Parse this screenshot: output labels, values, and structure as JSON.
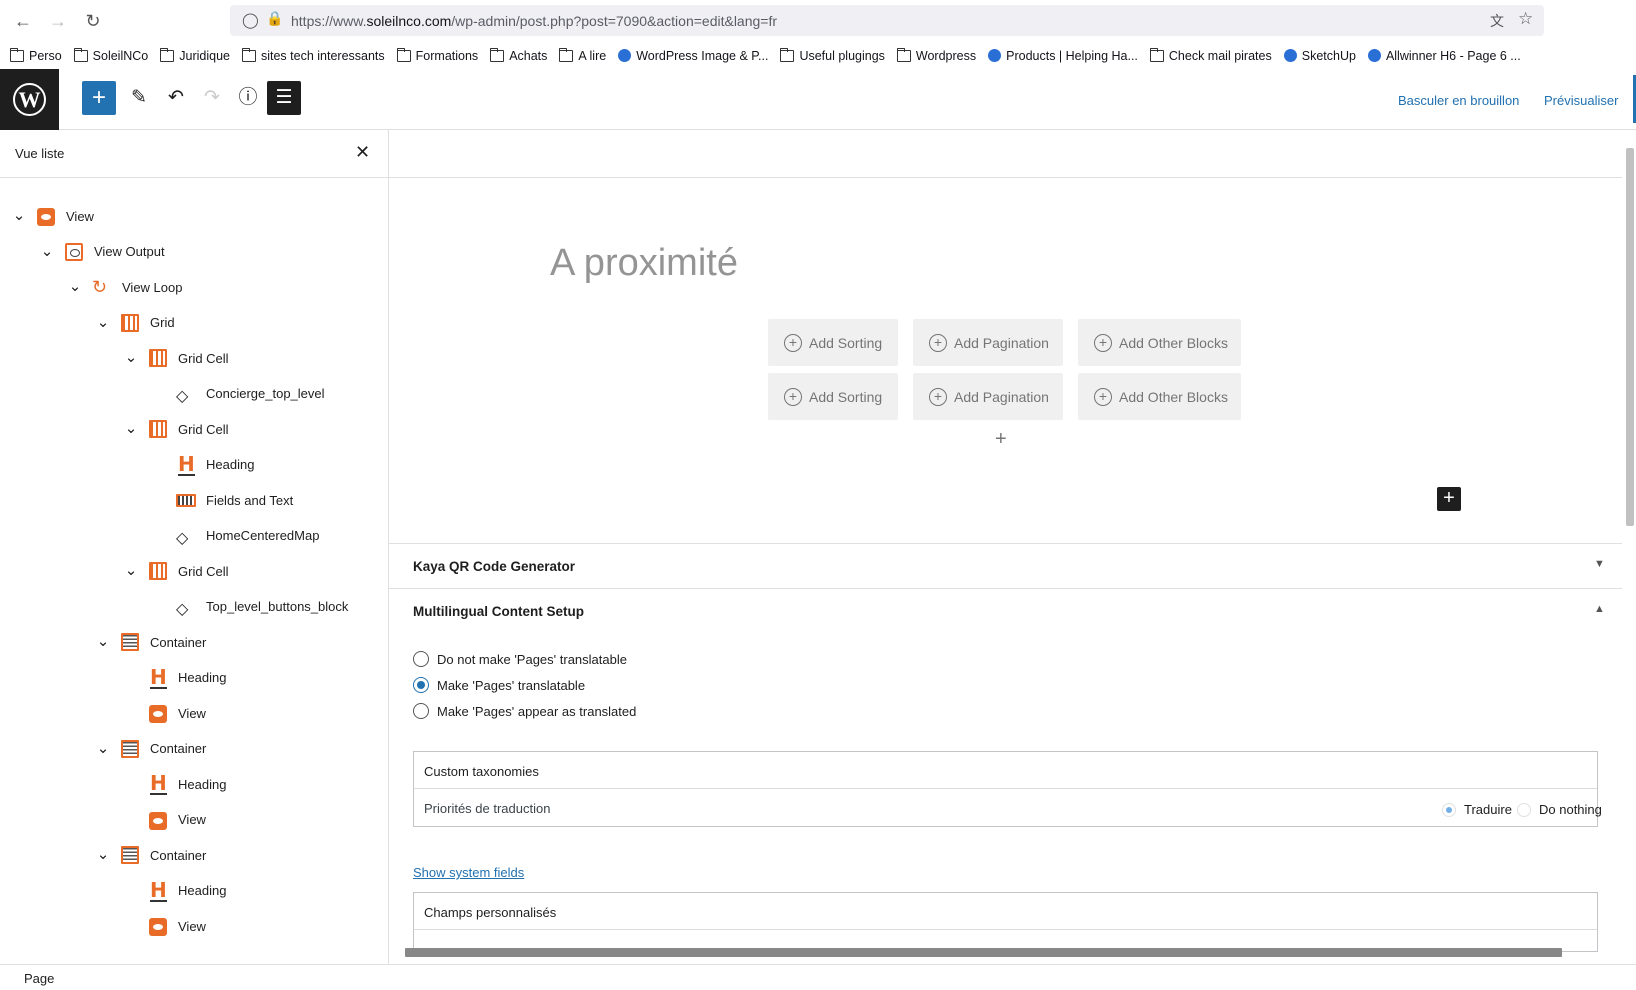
{
  "browser": {
    "url_prefix": "https://www.",
    "url_host": "soleilnco.com",
    "url_path": "/wp-admin/post.php?post=7090&action=edit&lang=fr",
    "bookmarks": [
      {
        "label": "Perso",
        "icon": "folder-icon"
      },
      {
        "label": "SoleilNCo",
        "icon": "folder-icon"
      },
      {
        "label": "Juridique",
        "icon": "folder-icon"
      },
      {
        "label": "sites tech interessants",
        "icon": "folder-icon"
      },
      {
        "label": "Formations",
        "icon": "folder-icon"
      },
      {
        "label": "Achats",
        "icon": "folder-icon"
      },
      {
        "label": "A lire",
        "icon": "folder-icon"
      },
      {
        "label": "WordPress Image & P...",
        "icon": "site-icon"
      },
      {
        "label": "Useful plugings",
        "icon": "folder-icon"
      },
      {
        "label": "Wordpress",
        "icon": "folder-icon"
      },
      {
        "label": "Products | Helping Ha...",
        "icon": "site-icon"
      },
      {
        "label": "Check mail pirates",
        "icon": "folder-icon"
      },
      {
        "label": "SketchUp",
        "icon": "site-icon"
      },
      {
        "label": "Allwinner H6 - Page 6 ...",
        "icon": "site-icon"
      }
    ]
  },
  "toolbar": {
    "switch_draft": "Basculer en brouillon",
    "preview": "Prévisualiser"
  },
  "sidebar": {
    "title": "Vue liste",
    "rows": [
      {
        "label": "View",
        "icon": "view"
      },
      {
        "label": "View Output",
        "icon": "output"
      },
      {
        "label": "View Loop",
        "icon": "loop"
      },
      {
        "label": "Grid",
        "icon": "grid"
      },
      {
        "label": "Grid Cell",
        "icon": "grid"
      },
      {
        "label": "Concierge_top_level",
        "icon": "diamond"
      },
      {
        "label": "Grid Cell",
        "icon": "grid"
      },
      {
        "label": "Heading",
        "icon": "h"
      },
      {
        "label": "Fields and Text",
        "icon": "fields"
      },
      {
        "label": "HomeCenteredMap",
        "icon": "diamond"
      },
      {
        "label": "Grid Cell",
        "icon": "grid"
      },
      {
        "label": "Top_level_buttons_block",
        "icon": "diamond"
      },
      {
        "label": "Container",
        "icon": "container"
      },
      {
        "label": "Heading",
        "icon": "h"
      },
      {
        "label": "View",
        "icon": "view"
      },
      {
        "label": "Container",
        "icon": "container"
      },
      {
        "label": "Heading",
        "icon": "h"
      },
      {
        "label": "View",
        "icon": "view"
      },
      {
        "label": "Container",
        "icon": "container"
      },
      {
        "label": "Heading",
        "icon": "h"
      },
      {
        "label": "View",
        "icon": "view"
      }
    ]
  },
  "editor": {
    "page_title": "A proximité",
    "add_sorting": "Add Sorting",
    "add_pagination": "Add Pagination",
    "add_other": "Add Other Blocks"
  },
  "metaboxes": {
    "kaya": "Kaya QR Code Generator",
    "multilingual": "Multilingual Content Setup",
    "radio_1": "Do not make 'Pages' translatable",
    "radio_2": "Make 'Pages' translatable",
    "radio_3": "Make 'Pages' appear as translated",
    "custom_tax": "Custom taxonomies",
    "priorities": "Priorités de traduction",
    "translate": "Traduire",
    "do_nothing": "Do nothing",
    "show_system": "Show system fields",
    "custom_fields": "Champs personnalisés"
  },
  "footer": {
    "label": "Page"
  }
}
